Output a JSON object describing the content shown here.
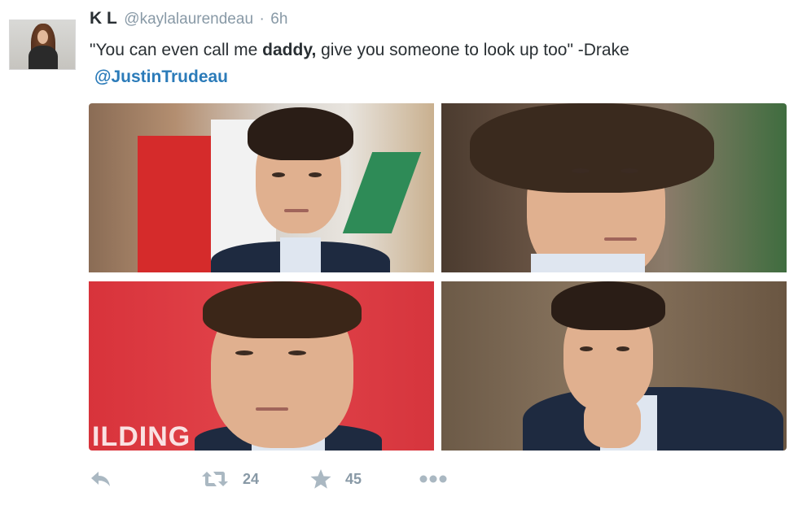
{
  "author": {
    "fullname": "K L",
    "username": "@kaylalaurendeau",
    "separator": "·",
    "time": "6h"
  },
  "tweet": {
    "text_before": "\"You can even call me ",
    "text_bold": "daddy,",
    "text_after": " give you someone to look up too\" -Drake",
    "mention": "@JustinTrudeau"
  },
  "media": {
    "photo_count": 4,
    "sign_text": "ILDING"
  },
  "actions": {
    "retweet_count": "24",
    "favorite_count": "45"
  },
  "colors": {
    "link": "#2b7bb9",
    "muted": "#8899a6",
    "icon": "#aab8c2",
    "text": "#292f33"
  },
  "icons": [
    "reply-icon",
    "retweet-icon",
    "star-icon",
    "more-icon"
  ]
}
